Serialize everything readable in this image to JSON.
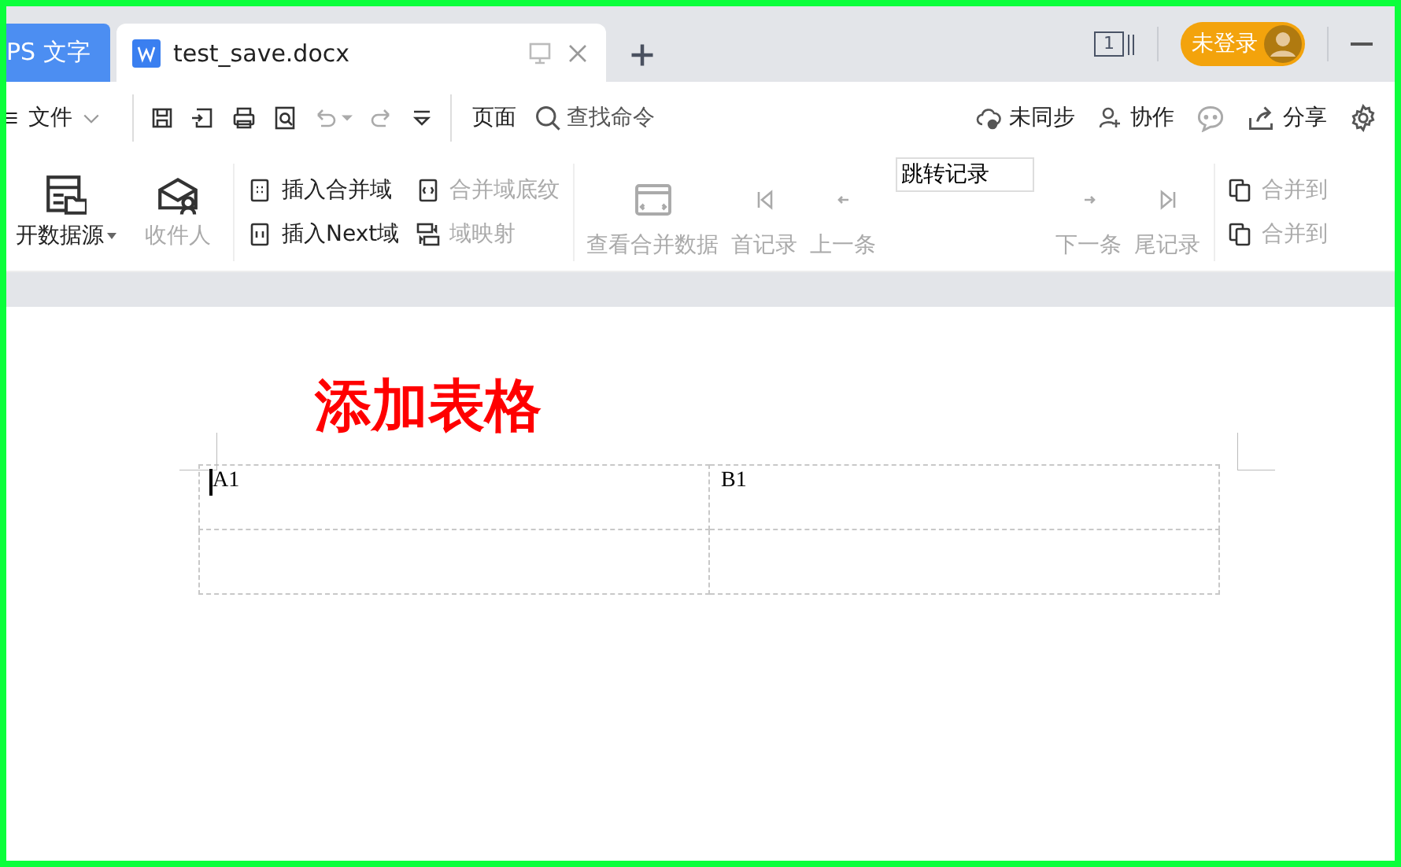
{
  "tabs": [
    {
      "kind": "app",
      "label": "PS 文字",
      "selected": false
    },
    {
      "kind": "doc",
      "label": "test_save.docx",
      "selected": true
    }
  ],
  "title_bar": {
    "page_count": "1",
    "login": "未登录"
  },
  "quick_toolbar": {
    "menu": "文件",
    "page_menu": "页面",
    "search": {
      "placeholder": "查找命令"
    },
    "actions": [
      {
        "kind": "sync",
        "label": "未同步"
      },
      {
        "kind": "collab",
        "label": "协作"
      },
      {
        "kind": "comment"
      },
      {
        "kind": "share",
        "label": "分享"
      },
      {
        "kind": "settings"
      }
    ]
  },
  "ribbon": {
    "large_buttons": [
      {
        "kind": "datasource",
        "label": "开数据源",
        "dropdown": true,
        "disabled": false
      },
      {
        "kind": "recipients",
        "label": "收件人",
        "dropdown": false,
        "disabled": true
      }
    ],
    "small_buttons": [
      {
        "kind": "insert-field",
        "label": "插入合并域",
        "disabled": false
      },
      {
        "kind": "shading",
        "label": "合并域底纹",
        "disabled": true
      },
      {
        "kind": "next-field",
        "label": "插入Next域",
        "disabled": false
      },
      {
        "kind": "mapping",
        "label": "域映射",
        "disabled": true
      }
    ],
    "navigation": [
      {
        "kind": "view",
        "label": "查看合并数据",
        "disabled": true
      },
      {
        "kind": "first",
        "label": "首记录",
        "disabled": true
      },
      {
        "kind": "prev",
        "label": "上一条",
        "disabled": true
      },
      {
        "kind": "jump",
        "value": "跳转记录"
      },
      {
        "kind": "next",
        "label": "下一条",
        "disabled": true
      },
      {
        "kind": "last",
        "label": "尾记录",
        "disabled": true
      }
    ],
    "merge_buttons": [
      {
        "label": "合并到",
        "disabled": true
      },
      {
        "label": "合并到",
        "disabled": true
      }
    ]
  },
  "document": {
    "heading": "添加表格",
    "table": {
      "rows": [
        [
          "A1",
          "B1"
        ],
        [
          "",
          ""
        ]
      ]
    }
  }
}
